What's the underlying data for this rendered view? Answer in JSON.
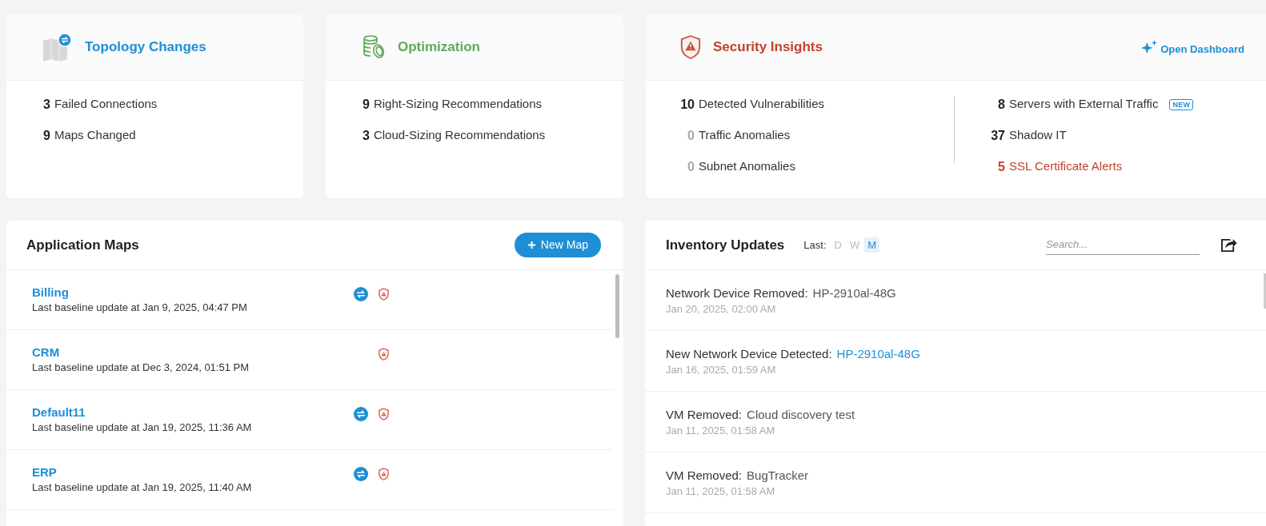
{
  "summary_cards": [
    {
      "kind": "topology",
      "title": "Topology Changes",
      "stats": [
        {
          "value": "3",
          "label": "Failed Connections",
          "kind": "normal"
        },
        {
          "value": "9",
          "label": "Maps Changed",
          "kind": "normal"
        }
      ]
    },
    {
      "kind": "optimization",
      "title": "Optimization",
      "stats": [
        {
          "value": "9",
          "label": "Right-Sizing Recommendations",
          "kind": "normal"
        },
        {
          "value": "3",
          "label": "Cloud-Sizing Recommendations",
          "kind": "normal"
        }
      ]
    },
    {
      "kind": "security",
      "title": "Security Insights",
      "link": "Open Dashboard",
      "stats": [
        {
          "value": "10",
          "label": "Detected Vulnerabilities",
          "kind": "normal"
        },
        {
          "value": "0",
          "label": "Traffic Anomalies",
          "kind": "muted"
        },
        {
          "value": "0",
          "label": "Subnet Anomalies",
          "kind": "muted"
        }
      ],
      "stats_right": [
        {
          "value": "8",
          "label": "Servers with External Traffic",
          "kind": "normal",
          "badge": "NEW"
        },
        {
          "value": "37",
          "label": "Shadow IT",
          "kind": "normal"
        },
        {
          "value": "5",
          "label": "SSL Certificate Alerts",
          "kind": "alert"
        }
      ]
    }
  ],
  "application_maps": {
    "title": "Application Maps",
    "new_button": "New Map",
    "rows": [
      {
        "name": "Billing",
        "subtitle": "Last baseline update at Jan 9, 2025, 04:47 PM",
        "topology_change": true,
        "security_alert": true
      },
      {
        "name": "CRM",
        "subtitle": "Last baseline update at Dec 3, 2024, 01:51 PM",
        "topology_change": false,
        "security_alert": true
      },
      {
        "name": "Default11",
        "subtitle": "Last baseline update at Jan 19, 2025, 11:36 AM",
        "topology_change": true,
        "security_alert": true
      },
      {
        "name": "ERP",
        "subtitle": "Last baseline update at Jan 19, 2025, 11:40 AM",
        "topology_change": true,
        "security_alert": true
      }
    ]
  },
  "inventory_updates": {
    "title": "Inventory Updates",
    "period_label": "Last:",
    "periods": [
      {
        "label": "D",
        "selected": false
      },
      {
        "label": "W",
        "selected": false
      },
      {
        "label": "M",
        "selected": true
      }
    ],
    "search": {
      "placeholder": "Search..."
    },
    "rows": [
      {
        "event": "Network Device Removed:",
        "subject": "HP-2910al-48G",
        "subject_link": false,
        "date": "Jan 20, 2025, 02:00 AM"
      },
      {
        "event": "New Network Device Detected:",
        "subject": "HP-2910al-48G",
        "subject_link": true,
        "date": "Jan 16, 2025, 01:59 AM"
      },
      {
        "event": "VM Removed:",
        "subject": "Cloud discovery test",
        "subject_link": false,
        "date": "Jan 11, 2025, 01:58 AM"
      },
      {
        "event": "VM Removed:",
        "subject": "BugTracker",
        "subject_link": false,
        "date": "Jan 11, 2025, 01:58 AM"
      }
    ]
  }
}
